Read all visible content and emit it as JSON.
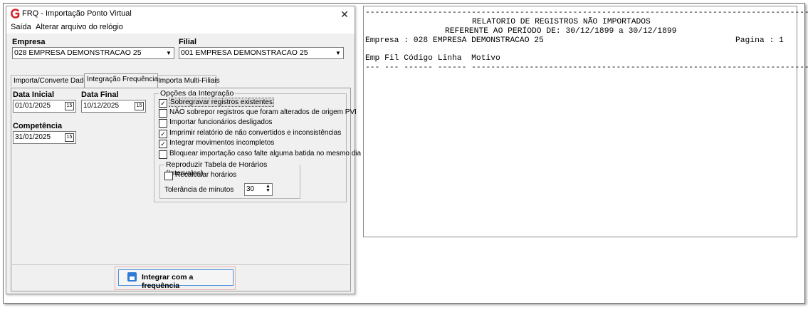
{
  "window": {
    "title": "FRQ - Importação Ponto Virtual",
    "close_glyph": "✕"
  },
  "menu": {
    "items": [
      "Saída",
      "Alterar arquivo do relógio"
    ]
  },
  "empresa": {
    "label": "Empresa",
    "value": "028 EMPRESA DEMONSTRACAO 25"
  },
  "filial": {
    "label": "Filial",
    "value": "001 EMPRESA DEMONSTRACAO 25"
  },
  "tabs": [
    {
      "label": "Importa/Converte Dados",
      "active": false
    },
    {
      "label": "Integração Frequência",
      "active": true
    },
    {
      "label": "Importa Multi-Filiais",
      "active": false
    }
  ],
  "dates": {
    "data_inicial_label": "Data Inicial",
    "data_inicial_value": "01/01/2025",
    "data_final_label": "Data Final",
    "data_final_value": "10/12/2025",
    "competencia_label": "Competência",
    "competencia_value": "31/01/2025",
    "calendar_glyph": "15"
  },
  "options": {
    "title": "Opções da Integração",
    "items": [
      {
        "label": "Sobregravar registros existentes",
        "checked": true,
        "focused": true
      },
      {
        "label": "NÃO sobrepor registros que foram alterados de origem PVI",
        "checked": false
      },
      {
        "label": "Importar funcionários desligados",
        "checked": false
      },
      {
        "label": "Imprimir relatório de não convertidos e inconsistências",
        "checked": true
      },
      {
        "label": "Integrar movimentos incompletos",
        "checked": true
      },
      {
        "label": "Bloquear importação caso falte alguma batida no mesmo dia",
        "checked": false
      }
    ]
  },
  "schedule": {
    "title": "Reproduzir Tabela de Horários (Intervalos)",
    "recalc_label": "Recalcular horários",
    "recalc_checked": false,
    "tolerance_label": "Tolerância de minutos",
    "tolerance_value": "30"
  },
  "action": {
    "label": "Integrar com a frequência"
  },
  "report": {
    "separator": "--------------------------------------------------------------------------------------------------",
    "title": "RELATORIO DE REGISTROS NÃO IMPORTADOS",
    "period": "REFERENTE AO PERÍODO DE: 30/12/1899 a 30/12/1899",
    "company": "Empresa : 028 EMPRESA DEMONSTRACAO 25",
    "page": "Pagina : 1",
    "columns": "Emp Fil Código Linha  Motivo",
    "underline": "--- --- ------ ------ --------------------------------------------------------------------------"
  }
}
